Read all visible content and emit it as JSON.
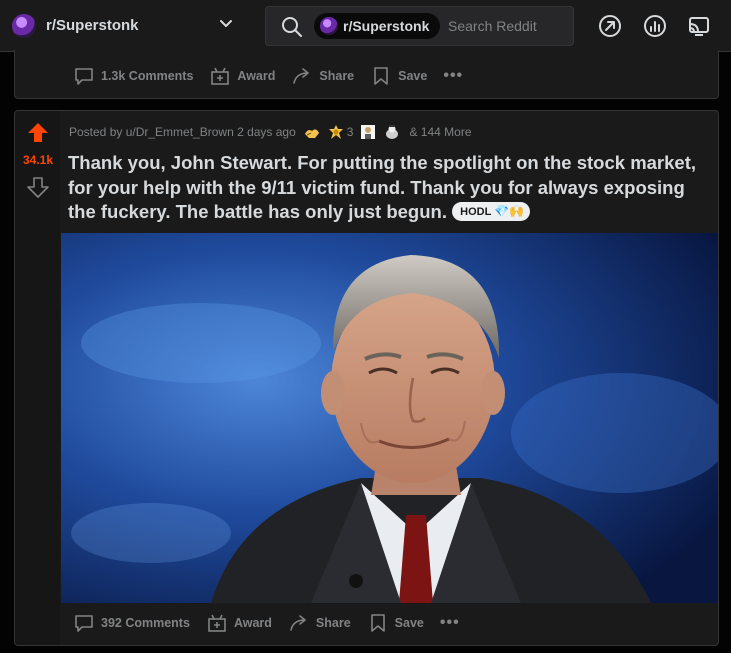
{
  "header": {
    "subreddit": "r/Superstonk",
    "search_chip": "r/Superstonk",
    "search_placeholder": "Search Reddit"
  },
  "prev_post": {
    "comments": "1.3k Comments",
    "award": "Award",
    "share": "Share",
    "save": "Save"
  },
  "post": {
    "votes": "34.1k",
    "posted_by": "Posted by u/Dr_Emmet_Brown 2 days ago",
    "award_count": "3",
    "more_awards": "& 144 More",
    "title": "Thank you, John Stewart. For putting the spotlight on the stock market, for your help with the 9/11 victim fund. Thank you for always exposing the fuckery. The battle has only just begun.",
    "flair": "HODL",
    "flair_emoji": "💎🙌",
    "comments": "392 Comments",
    "award": "Award",
    "share": "Share",
    "save": "Save"
  },
  "colors": {
    "upvote": "#ff4500",
    "background": "#030303",
    "card": "#1a1a1b",
    "muted_text": "#818384"
  }
}
